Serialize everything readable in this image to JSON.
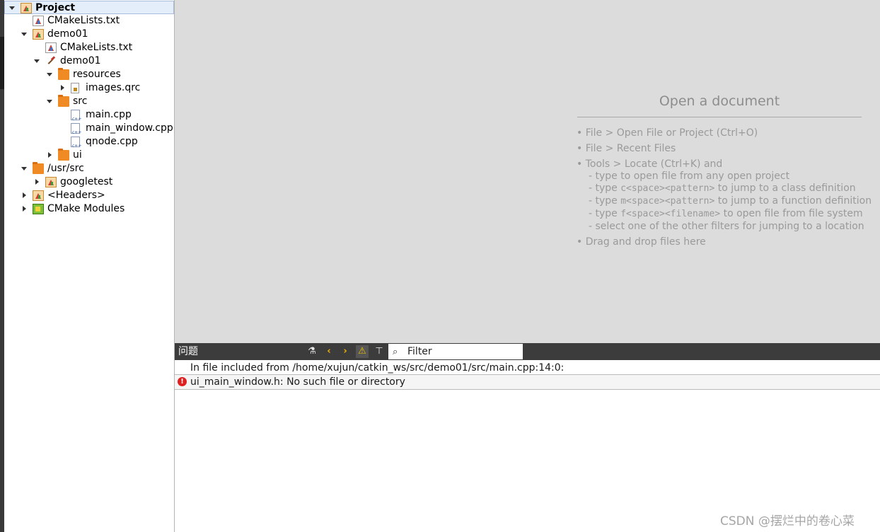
{
  "project_tree": {
    "items": [
      {
        "label": "Project",
        "icon": "cmake-project-icon",
        "expander": "expanded",
        "depth": 0,
        "selected": true
      },
      {
        "label": "CMakeLists.txt",
        "icon": "cmake-file-icon",
        "expander": "none",
        "depth": 1
      },
      {
        "label": "demo01",
        "icon": "cmake-project-icon",
        "expander": "expanded",
        "depth": 1
      },
      {
        "label": "CMakeLists.txt",
        "icon": "cmake-file-icon",
        "expander": "none",
        "depth": 2
      },
      {
        "label": "demo01",
        "icon": "hammer-icon",
        "expander": "expanded",
        "depth": 2
      },
      {
        "label": "resources",
        "icon": "folder-icon",
        "expander": "expanded",
        "depth": 3
      },
      {
        "label": "images.qrc",
        "icon": "qrc-file-icon",
        "expander": "collapsed",
        "depth": 4
      },
      {
        "label": "src",
        "icon": "folder-icon",
        "expander": "expanded",
        "depth": 3
      },
      {
        "label": "main.cpp",
        "icon": "cpp-file-icon",
        "expander": "none",
        "depth": 4
      },
      {
        "label": "main_window.cpp",
        "icon": "cpp-file-icon",
        "expander": "none",
        "depth": 4
      },
      {
        "label": "qnode.cpp",
        "icon": "cpp-file-icon",
        "expander": "none",
        "depth": 4
      },
      {
        "label": "ui",
        "icon": "folder-icon",
        "expander": "collapsed",
        "depth": 3
      },
      {
        "label": "/usr/src",
        "icon": "folder-icon",
        "expander": "expanded",
        "depth": 1
      },
      {
        "label": "googletest",
        "icon": "cmake-project-icon",
        "expander": "collapsed",
        "depth": 2
      },
      {
        "label": "<Headers>",
        "icon": "headers-icon",
        "expander": "collapsed",
        "depth": 1
      },
      {
        "label": "CMake Modules",
        "icon": "cmake-modules-icon",
        "expander": "collapsed",
        "depth": 1
      }
    ]
  },
  "editor": {
    "title": "Open a document",
    "hints": [
      {
        "text": "• File > Open File or Project (Ctrl+O)",
        "sub": false
      },
      {
        "text": "• File > Recent Files",
        "sub": false
      },
      {
        "text": "• Tools > Locate (Ctrl+K) and",
        "sub": false
      },
      {
        "text": "- type to open file from any open project",
        "sub": true
      },
      {
        "pre": "- type ",
        "code": "c<space><pattern>",
        "post": " to jump to a class definition",
        "sub": true
      },
      {
        "pre": "- type ",
        "code": "m<space><pattern>",
        "post": " to jump to a function definition",
        "sub": true
      },
      {
        "pre": "- type ",
        "code": "f<space><filename>",
        "post": " to open file from file system",
        "sub": true
      },
      {
        "text": "- select one of the other filters for jumping to a location",
        "sub": true
      },
      {
        "text": "• Drag and drop files here",
        "sub": false
      }
    ]
  },
  "issues": {
    "title": "问题",
    "toolbar": {
      "clear_icon": "clear-icon",
      "prev_icon": "chevron-left-icon",
      "next_icon": "chevron-right-icon",
      "warning_icon": "warning-icon",
      "filter_icon": "filter-icon"
    },
    "filter_placeholder": "Filter",
    "rows": [
      {
        "text": "In file included from /home/xujun/catkin_ws/src/demo01/src/main.cpp:14:0:",
        "severity": "none"
      },
      {
        "text": "ui_main_window.h: No such file or directory",
        "severity": "error"
      }
    ]
  },
  "watermark": "CSDN @摆烂中的卷心菜",
  "colors": {
    "editor_bg": "#dcdcdc",
    "panel_bar": "#3c3c3c",
    "selection": "#e4eefb",
    "error": "#e02020",
    "warning": "#f2c200",
    "nav_arrows": "#f0b400"
  }
}
